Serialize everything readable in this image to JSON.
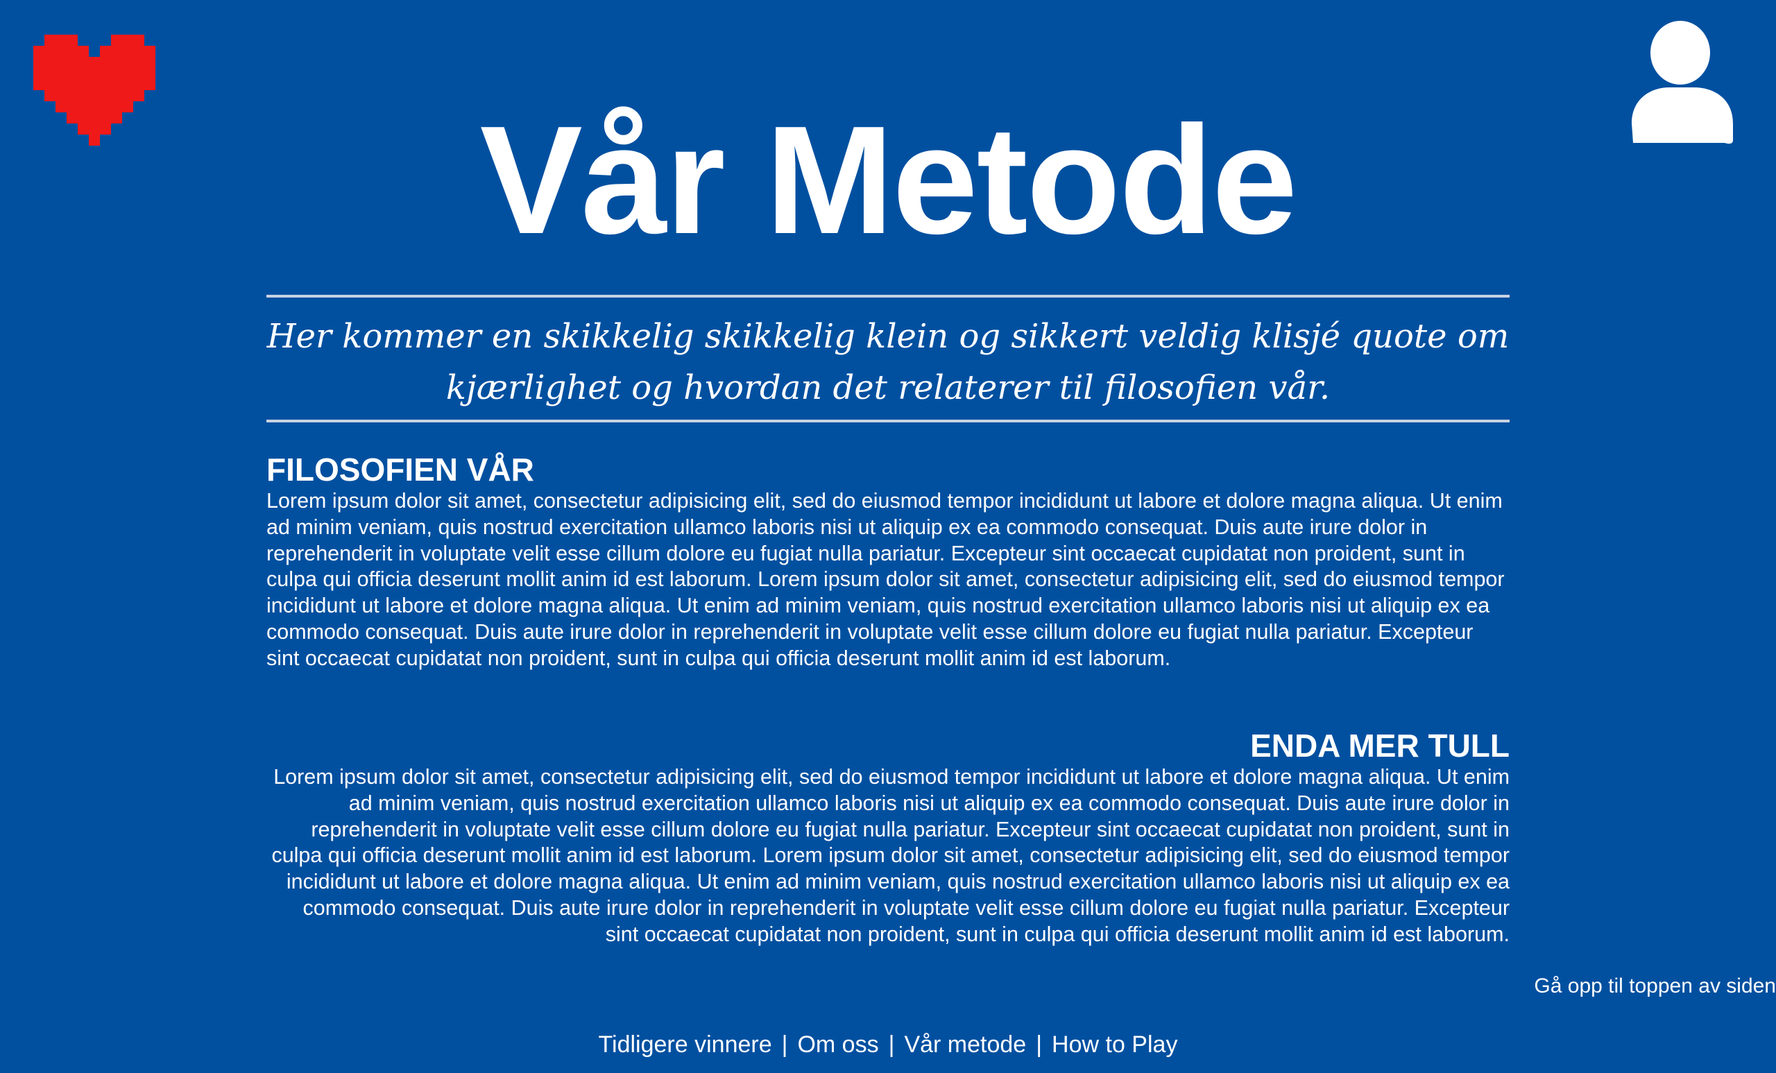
{
  "header": {
    "heart_icon": "pixel-heart-icon",
    "heart_color": "#f01919",
    "profile_icon": "user-profile-icon",
    "profile_color": "#ffffff"
  },
  "page": {
    "title": "Vår Metode",
    "quote": "Her kommer en skikkelig skikkelig klein og sikkert veldig klisjé quote om kjærlighet og hvordan det relaterer til filosofien vår.",
    "background": "#0150a0"
  },
  "sections": [
    {
      "heading": "FILOSOFIEN VÅR",
      "body": "Lorem ipsum dolor sit amet, consectetur adipisicing elit, sed do eiusmod tempor incididunt ut labore et dolore magna aliqua. Ut enim ad minim veniam, quis nostrud exercitation ullamco laboris nisi ut aliquip ex ea commodo consequat. Duis aute irure dolor in reprehenderit in voluptate velit esse cillum dolore eu fugiat nulla pariatur. Excepteur sint occaecat cupidatat non proident, sunt in culpa qui officia deserunt mollit anim id est laborum. Lorem ipsum dolor sit amet, consectetur adipisicing elit, sed do eiusmod tempor incididunt ut labore et dolore magna aliqua. Ut enim ad minim veniam, quis nostrud exercitation ullamco laboris nisi ut aliquip ex ea commodo consequat. Duis aute irure dolor in reprehenderit in voluptate velit esse cillum dolore eu fugiat nulla pariatur. Excepteur sint occaecat cupidatat non proident, sunt in culpa qui officia deserunt mollit anim id est laborum."
    },
    {
      "heading": "ENDA MER TULL",
      "body": "Lorem ipsum dolor sit amet, consectetur adipisicing elit, sed do eiusmod tempor incididunt ut labore et dolore magna aliqua. Ut enim ad minim veniam, quis nostrud exercitation ullamco laboris nisi ut aliquip ex ea commodo consequat. Duis aute irure dolor in reprehenderit in voluptate velit esse cillum dolore eu fugiat nulla pariatur. Excepteur sint occaecat cupidatat non proident, sunt in culpa qui officia deserunt mollit anim id est laborum. Lorem ipsum dolor sit amet, consectetur adipisicing elit, sed do eiusmod tempor incididunt ut labore et dolore magna aliqua. Ut enim ad minim veniam, quis nostrud exercitation ullamco laboris nisi ut aliquip ex ea commodo consequat. Duis aute irure dolor in reprehenderit in voluptate velit esse cillum dolore eu fugiat nulla pariatur. Excepteur sint occaecat cupidatat non proident, sunt in culpa qui officia deserunt mollit anim id est laborum."
    }
  ],
  "back_to_top": "Gå opp til toppen av siden",
  "footer": {
    "links": [
      "Tidligere vinnere",
      "Om oss",
      "Vår metode",
      "How to Play"
    ],
    "separator": "|"
  }
}
